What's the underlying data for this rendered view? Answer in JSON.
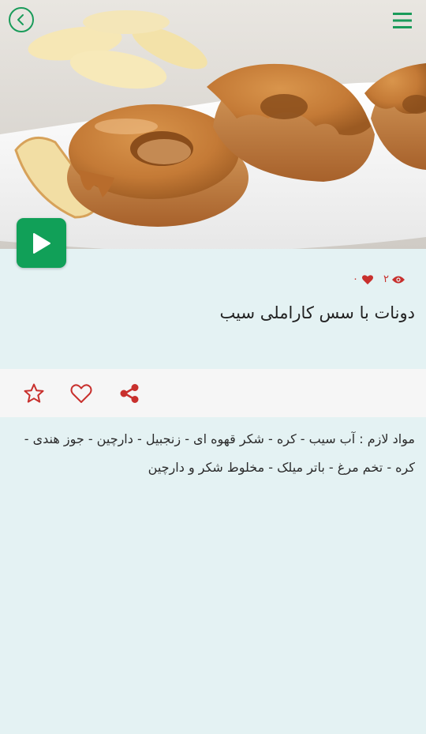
{
  "header": {
    "back_icon": "chevron-left-circle-icon",
    "menu_icon": "hamburger-menu-icon"
  },
  "hero": {
    "image_subject": "glazed caramel apple donuts on a white plate with apple slices",
    "play_icon": "play-icon"
  },
  "stats": {
    "likes": "۰",
    "views": "۲",
    "like_icon": "heart-icon",
    "view_icon": "eye-icon"
  },
  "recipe": {
    "title": "دونات با سس کاراملی سیب",
    "ingredients": "مواد لازم : آب سیب - کره - شکر قهوه ای - زنجبیل - دارچین - جوز هندی - کره - تخم مرغ - باتر میلک - مخلوط شکر و دارچین"
  },
  "actions": {
    "favorite_icon": "star-outline-icon",
    "like_icon": "heart-outline-icon",
    "share_icon": "share-icon"
  },
  "colors": {
    "accent_green": "#11a058",
    "accent_red": "#c8302d",
    "background": "#e4f2f3",
    "action_bar": "#f6f6f6"
  }
}
